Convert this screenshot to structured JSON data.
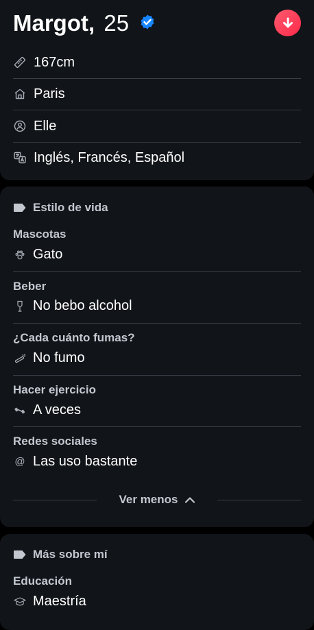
{
  "profile": {
    "name": "Margot,",
    "age": "25"
  },
  "basics": {
    "items": [
      {
        "icon": "ruler-icon",
        "label": "167cm"
      },
      {
        "icon": "home-icon",
        "label": "Paris"
      },
      {
        "icon": "pronoun-icon",
        "label": "Elle"
      },
      {
        "icon": "translate-icon",
        "label": "Inglés, Francés, Español"
      }
    ]
  },
  "lifestyle": {
    "heading": "Estilo de vida",
    "items": [
      {
        "label": "Mascotas",
        "value": "Gato",
        "icon": "paw-icon"
      },
      {
        "label": "Beber",
        "value": "No bebo alcohol",
        "icon": "wine-glass-icon"
      },
      {
        "label": "¿Cada cuánto fumas?",
        "value": "No fumo",
        "icon": "smoking-icon"
      },
      {
        "label": "Hacer ejercicio",
        "value": "A veces",
        "icon": "dumbbell-icon"
      },
      {
        "label": "Redes sociales",
        "value": "Las uso bastante",
        "icon": "at-icon"
      }
    ],
    "toggle_label": "Ver menos"
  },
  "more": {
    "heading": "Más sobre mí",
    "items": [
      {
        "label": "Educación",
        "value": "Maestría",
        "icon": "graduation-cap-icon"
      }
    ]
  },
  "colors": {
    "background": "#000000",
    "card": "#111418",
    "accent": "#fd3a52",
    "verified": "#1786ff",
    "muted_text": "#c3c8d0",
    "divider": "#3a3f47"
  }
}
